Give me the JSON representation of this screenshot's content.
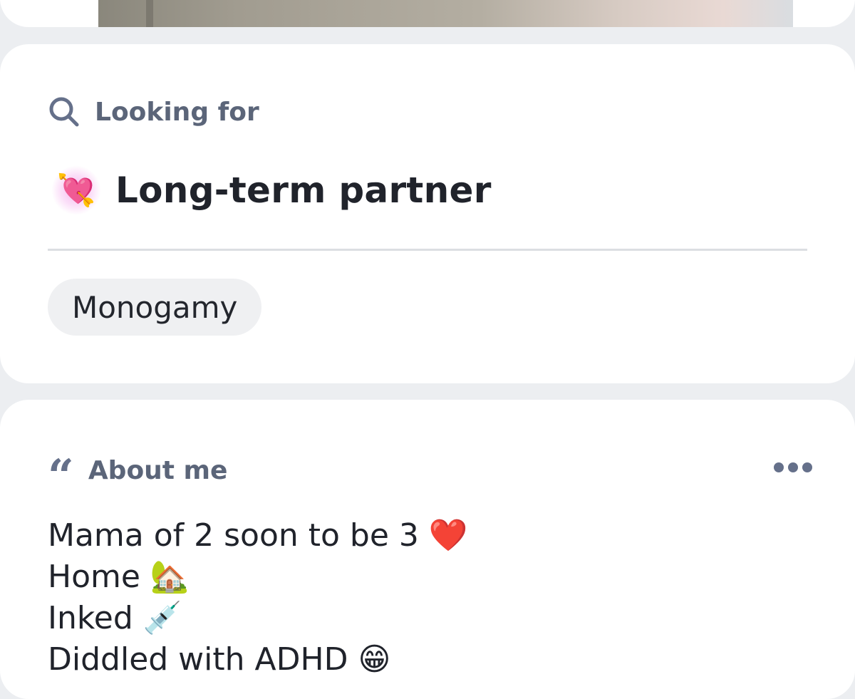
{
  "looking_for": {
    "header_label": "Looking for",
    "value_emoji": "💘",
    "value": "Long-term partner",
    "tag": "Monogamy"
  },
  "about_me": {
    "header_label": "About me",
    "quote_glyph": "“",
    "bio_lines": [
      "Mama of 2 soon to be 3 ❤️",
      "Home 🏡",
      "Inked 💉",
      "Diddled with ADHD 😁"
    ]
  },
  "icons": {
    "looking_for": "search-icon",
    "about_me": "quote-icon",
    "more": "more-options-icon",
    "value": "heart-with-arrow-icon"
  },
  "colors": {
    "background": "#eceef1",
    "card": "#ffffff",
    "header_text": "#5b6579",
    "body_text": "#20232b",
    "tag_bg": "#eff0f2",
    "accent_glow": "#e85adc"
  }
}
